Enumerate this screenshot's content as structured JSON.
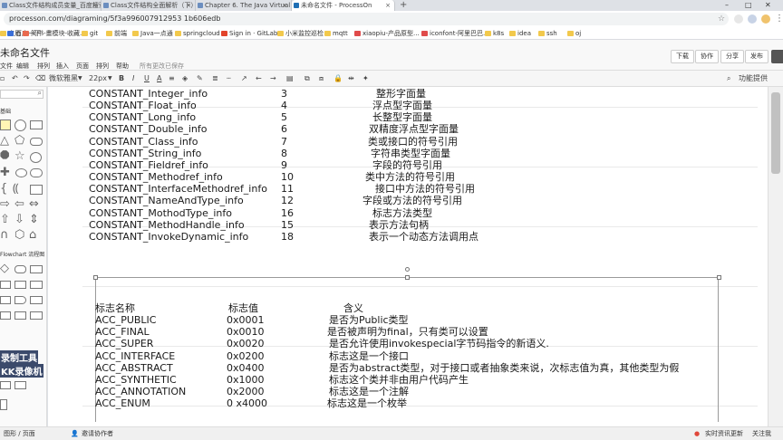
{
  "browser": {
    "tabs": [
      {
        "title": "Class文件结构成员变量_百度搜索",
        "active": false
      },
      {
        "title": "Class文件结构全面解析（下）",
        "active": false
      },
      {
        "title": "Chapter 6. The Java Virtual Ma",
        "active": false
      },
      {
        "title": "未命名文件 - ProcessOn",
        "active": true
      }
    ],
    "tab_close_glyph": "×",
    "new_tab_glyph": "+",
    "window_controls": [
      "–",
      "□",
      "✕"
    ],
    "url": "processon.com/diagraming/5f3a996007912953 1b606edb",
    "bookmarks": [
      "应用",
      "百度一下",
      "简书-畫模块-收藏...",
      "git",
      "前端",
      "Java一点通",
      "springcloud",
      "Sign in · GitLab",
      "小米监控巡检",
      "mqtt",
      "xiaopiu-产品原型...",
      "iconfont-阿里巴巴...",
      "k8s",
      "idea",
      "ssh",
      "oj"
    ]
  },
  "app": {
    "doc_title": "未命名文件",
    "menu": [
      "文件",
      "编辑",
      "排列",
      "插入",
      "页面",
      "排列",
      "帮助",
      "所有更改已保存"
    ],
    "header_buttons": [
      "下载",
      "协作",
      "分享",
      "发布"
    ],
    "toolbar": {
      "font_family": "微软雅黑",
      "font_size": "22px",
      "bold": "B",
      "italic": "I",
      "underline": "U",
      "font_color": "A",
      "right_label": "功能提供"
    },
    "sidebar": {
      "search_placeholder": "",
      "basic_heading": "基础",
      "flowchart_heading": "Flowchart 流程图",
      "watermark_1": "录制工具",
      "watermark_2": "KK录像机"
    }
  },
  "constant_table": [
    {
      "name": "CONSTANT_Integer_info",
      "tag": "3",
      "desc": "整形字面量"
    },
    {
      "name": "CONSTANT_Float_info",
      "tag": "4",
      "desc": "浮点型字面量"
    },
    {
      "name": "CONSTANT_Long_info",
      "tag": "5",
      "desc": "长整型字面量"
    },
    {
      "name": "CONSTANT_Double_info",
      "tag": "6",
      "desc": "双精度浮点型字面量"
    },
    {
      "name": "CONSTANT_Class_info",
      "tag": "7",
      "desc": "类或接口的符号引用"
    },
    {
      "name": "CONSTANT_String_info",
      "tag": "8",
      "desc": "字符串类型字面量"
    },
    {
      "name": "CONSTANT_Fieldref_info",
      "tag": "9",
      "desc": "字段的符号引用"
    },
    {
      "name": "CONSTANT_Methodref_info",
      "tag": "10",
      "desc": "类中方法的符号引用"
    },
    {
      "name": "CONSTANT_InterfaceMethodref_info",
      "tag": "11",
      "desc": "接口中方法的符号引用"
    },
    {
      "name": "CONSTANT_NameAndType_info",
      "tag": "12",
      "desc": "字段或方法的符号引用"
    },
    {
      "name": "CONSTANT_MothodType_info",
      "tag": "16",
      "desc": "标志方法类型"
    },
    {
      "name": "CONSTANT_MethodHandle_info",
      "tag": "15",
      "desc": "表示方法句柄"
    },
    {
      "name": "CONSTANT_InvokeDynamic_info",
      "tag": "18",
      "desc": "表示一个动态方法调用点"
    }
  ],
  "access_flags": {
    "headers": [
      "标志名称",
      "标志值",
      "含义"
    ],
    "rows": [
      {
        "name": "ACC_PUBLIC",
        "value": "0x0001",
        "meaning": "是否为Public类型"
      },
      {
        "name": "ACC_FINAL",
        "value": "0x0010",
        "meaning": "是否被声明为final，只有类可以设置"
      },
      {
        "name": "ACC_SUPER",
        "value": "0x0020",
        "meaning": "是否允许使用invokespecial字节码指令的新语义."
      },
      {
        "name": "ACC_INTERFACE",
        "value": "0x0200",
        "meaning": "标志这是一个接口"
      },
      {
        "name": "ACC_ABSTRACT",
        "value": "0x0400",
        "meaning": "是否为abstract类型，对于接口或者抽象类来说，次标志值为真，其他类型为假"
      },
      {
        "name": "ACC_SYNTHETIC",
        "value": "0x1000",
        "meaning": "标志这个类并非由用户代码产生"
      },
      {
        "name": "ACC_ANNOTATION",
        "value": "0x2000",
        "meaning": "标志这是一个注解"
      },
      {
        "name": "ACC_ENUM",
        "value": "0 x4000",
        "meaning": "标志这是一个枚举"
      }
    ]
  },
  "status": {
    "left": "图形 / 页面",
    "invite": "邀请协作者",
    "realtime": "实时资讯更新",
    "follow": "关注我"
  }
}
